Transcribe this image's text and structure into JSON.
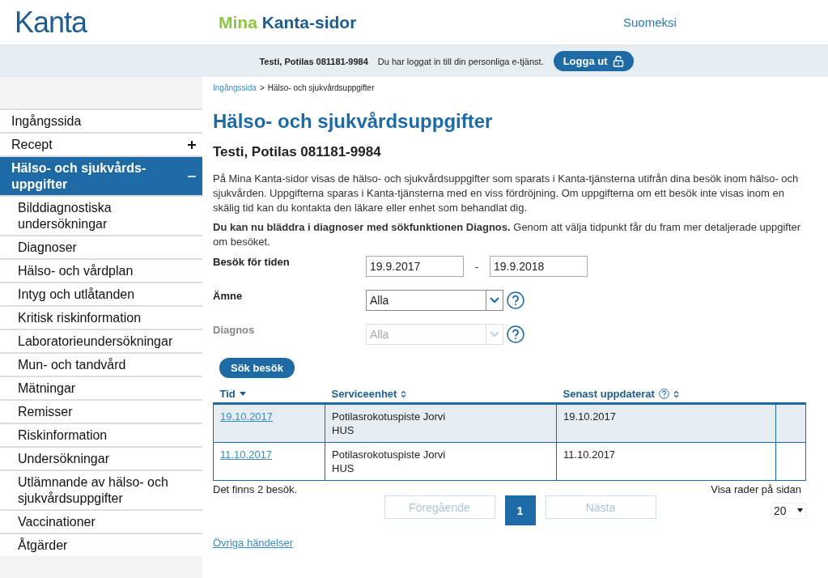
{
  "header": {
    "logo": "Kanta",
    "site_title_first": "Mina",
    "site_title_rest": "Kanta-sidor",
    "language_link": "Suomeksi"
  },
  "user_bar": {
    "user": "Testi, Potilas 081181-9984",
    "message": "Du har loggat in till din personliga e-tjänst.",
    "logout_button": "Logga ut"
  },
  "sidebar": {
    "items": [
      {
        "label": "Ingångssida",
        "selected": false
      },
      {
        "label": "Recept",
        "selected": false,
        "expanded": false
      },
      {
        "label": "Hälso- och sjukvårds-uppgifter",
        "selected": true,
        "expanded": true,
        "children": [
          {
            "label": "Bilddiagnostiska undersökningar",
            "selected": false
          },
          {
            "label": "Diagnoser",
            "selected": false
          },
          {
            "label": "Hälso- och vårdplan",
            "selected": false
          },
          {
            "label": "Intyg och utlåtanden",
            "selected": false
          },
          {
            "label": "Kritisk riskinformation",
            "selected": false
          },
          {
            "label": "Laboratorieundersökningar",
            "selected": false
          },
          {
            "label": "Mun- och tandvård",
            "selected": false
          },
          {
            "label": "Mätningar",
            "selected": false
          },
          {
            "label": "Remisser",
            "selected": false
          },
          {
            "label": "Riskinformation",
            "selected": false
          },
          {
            "label": "Undersökningar",
            "selected": false
          },
          {
            "label": "Utlämnande av hälso- och sjukvårdsuppgifter",
            "selected": false
          },
          {
            "label": "Vaccinationer",
            "selected": false
          },
          {
            "label": "Åtgärder",
            "selected": false
          }
        ]
      }
    ]
  },
  "breadcrumb": [
    {
      "label": "Ingångssida",
      "link": true
    },
    {
      "label": ">",
      "link": false
    },
    {
      "label": "Hälso- och sjukvårdsuppgifter",
      "link": false
    }
  ],
  "page_title": "Hälso- och sjukvårdsuppgifter",
  "patient_name": "Testi, Potilas 081181-9984",
  "intro": "På Mina Kanta-sidor visas de hälso- och sjukvårdsuppgifter som sparats i Kanta-tjänsterna utifrån dina besök inom hälso- och sjukvården. Uppgifterna sparas i Kanta-tjänsterna med en viss fördröjning. Om uppgifterna om ett besök inte visas inom en skälig tid kan du kontakta den läkare eller enhet som behandlat dig.",
  "notice": "**Du kan nu bläddra i diagnoser med sökfunktionen Diagnos.** Genom att välja tidpunkt får du fram mer detaljerade uppgifter om besöket.",
  "search_form": {
    "period_label": "Besök för tiden",
    "date_from": "19.9.2017",
    "date_separator": "-",
    "date_to": "19.9.2018",
    "fields": [
      {
        "label": "Ämne",
        "value": "Alla",
        "disabled": false
      },
      {
        "label": "Diagnos",
        "value": "Alla",
        "disabled": true
      }
    ],
    "search_button": "Sök besök"
  },
  "table": {
    "columns": [
      {
        "label": "Tid",
        "sorted": true,
        "help": false
      },
      {
        "label": "Serviceenhet",
        "sorted": false,
        "help": false
      },
      {
        "label": "Senast uppdaterat",
        "sorted": false,
        "help": true
      }
    ],
    "rows": [
      {
        "date": "19.10.2017",
        "unit": "Potilasrokotuspiste Jorvi",
        "organization": "HUS",
        "updated": "19.10.2017",
        "selected": true
      },
      {
        "date": "11.10.2017",
        "unit": "Potilasrokotuspiste Jorvi",
        "organization": "HUS",
        "updated": "11.10.2017",
        "selected": false
      }
    ]
  },
  "result_count": "Det finns 2 besök.",
  "rows_per_page_label": "Visa rader på sidan",
  "rows_per_page": "20",
  "pagination": {
    "previous": {
      "label": "Föregående",
      "disabled": true
    },
    "pages": [
      {
        "label": "1",
        "selected": true
      }
    ],
    "next": {
      "label": "Nästa",
      "disabled": true
    }
  },
  "other_events_link": "Övriga händelser"
}
